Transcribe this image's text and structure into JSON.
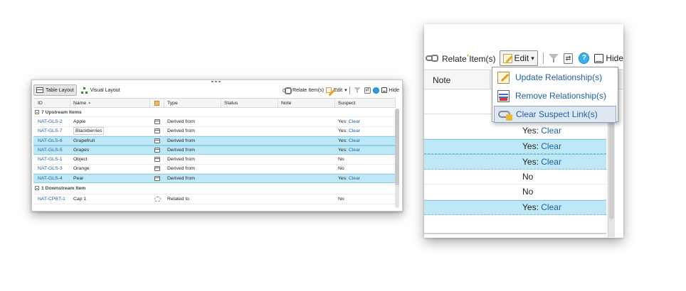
{
  "left_panel": {
    "tabs": [
      {
        "label": "Table Layout",
        "icon": "table-icon",
        "active": true
      },
      {
        "label": "Visual Layout",
        "icon": "tree-icon",
        "active": false
      }
    ],
    "toolbar": {
      "relate_label": "Relate Item(s)",
      "edit_label": "Edit",
      "hide_label": "Hide"
    },
    "columns": [
      "ID",
      "Name",
      "",
      "Type",
      "Status",
      "Note",
      "Suspect"
    ],
    "sort_indicator": "▲",
    "groups": [
      {
        "label": "7 Upstream Items",
        "rows": [
          {
            "id": "NAT-GLS-2",
            "name": "Apple",
            "type": "Derived from",
            "status": "",
            "note": "",
            "suspect_prefix": "Yes:",
            "suspect_link": "Clear",
            "selected": false,
            "icon": "document-icon"
          },
          {
            "id": "NAT-GLS-7",
            "name": "Blackberries",
            "type": "Derived from",
            "status": "",
            "note": "",
            "suspect_prefix": "Yes:",
            "suspect_link": "Clear",
            "selected": false,
            "icon": "document-icon"
          },
          {
            "id": "NAT-GLS-6",
            "name": "Grapefruit",
            "type": "Derived from",
            "status": "",
            "note": "",
            "suspect_prefix": "Yes:",
            "suspect_link": "Clear",
            "selected": true,
            "icon": "document-icon"
          },
          {
            "id": "NAT-GLS-5",
            "name": "Grapes",
            "type": "Derived from",
            "status": "",
            "note": "",
            "suspect_prefix": "Yes:",
            "suspect_link": "Clear",
            "selected": true,
            "icon": "document-icon"
          },
          {
            "id": "NAT-GLS-1",
            "name": "Object",
            "type": "Derived from",
            "status": "",
            "note": "",
            "suspect_prefix": "No",
            "suspect_link": "",
            "selected": false,
            "icon": "document-icon"
          },
          {
            "id": "NAT-GLS-3",
            "name": "Orange",
            "type": "Derived from",
            "status": "",
            "note": "",
            "suspect_prefix": "No",
            "suspect_link": "",
            "selected": false,
            "icon": "document-icon"
          },
          {
            "id": "NAT-GLS-4",
            "name": "Pear",
            "type": "Derived from",
            "status": "",
            "note": "",
            "suspect_prefix": "Yes:",
            "suspect_link": "Clear",
            "selected": true,
            "icon": "document-icon"
          }
        ]
      },
      {
        "label": "1 Downstream Item",
        "rows": [
          {
            "id": "NAT-CPBT-1",
            "name": "Cap 1",
            "type": "Related to",
            "status": "",
            "note": "",
            "suspect_prefix": "No",
            "suspect_link": "",
            "selected": false,
            "icon": "cap-icon"
          }
        ]
      }
    ]
  },
  "right_panel": {
    "toolbar": {
      "relate_label": "Relate",
      "relate_star": "*",
      "relate_suffix": "Item(s)",
      "edit_label": "Edit",
      "edit_caret": "▾",
      "hide_label": "Hide"
    },
    "note_header": "Note",
    "menu": [
      {
        "label": "Update Relationship(s)",
        "icon": "update-relationship-icon",
        "highlighted": false
      },
      {
        "label": "Remove Relationship(s)",
        "icon": "remove-relationship-icon",
        "highlighted": false
      },
      {
        "label": "Clear Suspect Link(s)",
        "icon": "clear-suspect-icon",
        "highlighted": true
      }
    ],
    "suspect_rows": [
      {
        "prefix": "Yes:",
        "link": "Clear",
        "selected": false
      },
      {
        "prefix": "Yes:",
        "link": "Clear",
        "selected": true
      },
      {
        "prefix": "Yes:",
        "link": "Clear",
        "selected": true
      },
      {
        "prefix": "No",
        "link": "",
        "selected": false
      },
      {
        "prefix": "No",
        "link": "",
        "selected": false
      },
      {
        "prefix": "Yes:",
        "link": "Clear",
        "selected": true
      }
    ]
  },
  "colors": {
    "link": "#1f5fa8",
    "selected_row": "#bfe8f6",
    "menu_highlight": "#dde8f3"
  }
}
